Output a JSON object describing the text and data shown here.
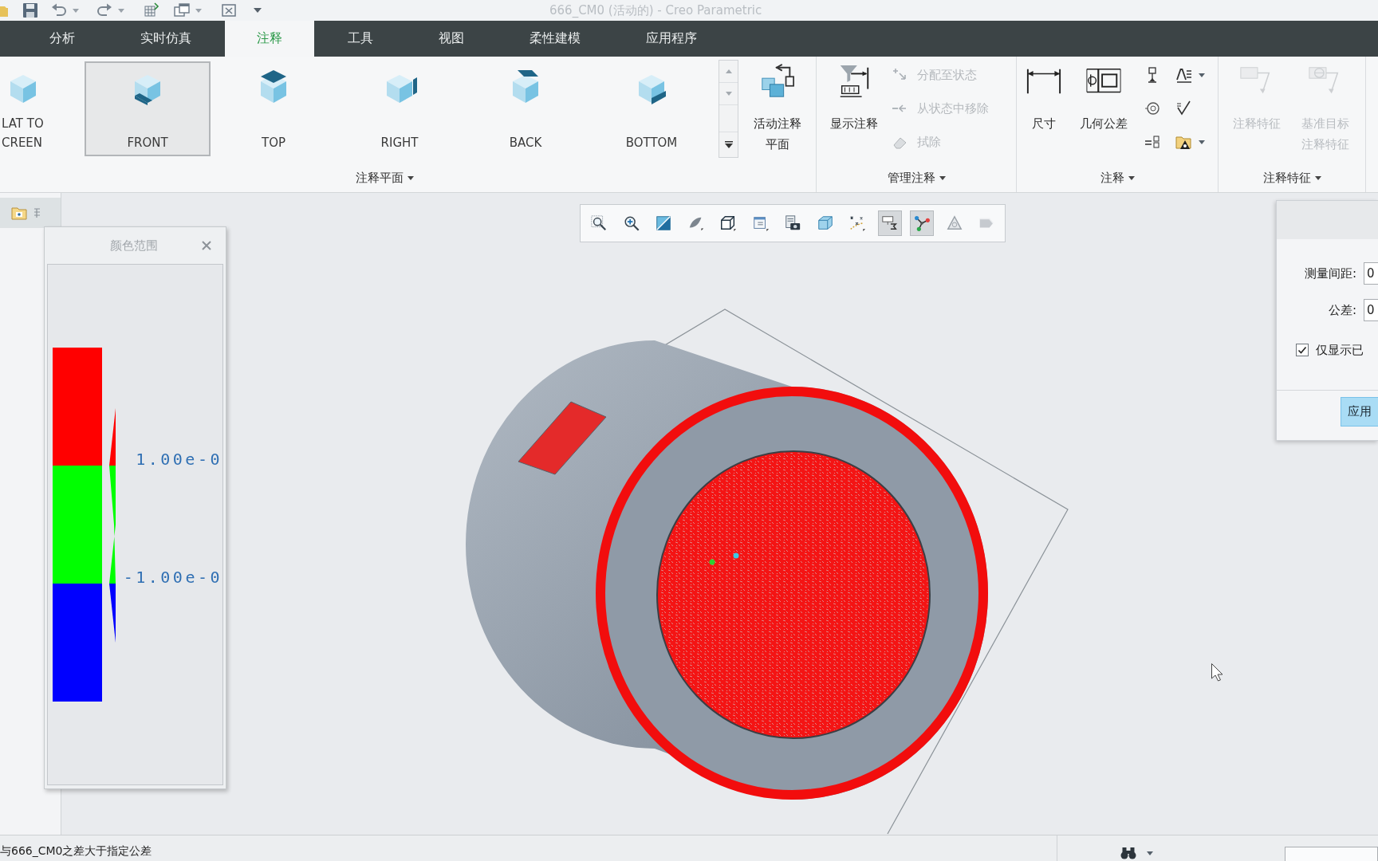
{
  "title_bar": {
    "title": "666_CM0 (活动的) - Creo Parametric"
  },
  "tabs": [
    {
      "label": "分析",
      "selected": false
    },
    {
      "label": "实时仿真",
      "selected": false
    },
    {
      "label": "注释",
      "selected": true
    },
    {
      "label": "工具",
      "selected": false
    },
    {
      "label": "视图",
      "selected": false
    },
    {
      "label": "柔性建模",
      "selected": false
    },
    {
      "label": "应用程序",
      "selected": false
    }
  ],
  "ribbon": {
    "groups": [
      {
        "label": "注释平面",
        "gallery": [
          {
            "label": "LAT TO\nCREEN",
            "selected": false
          },
          {
            "label": "FRONT",
            "selected": true
          },
          {
            "label": "TOP",
            "selected": false
          },
          {
            "label": "RIGHT",
            "selected": false
          },
          {
            "label": "BACK",
            "selected": false
          },
          {
            "label": "BOTTOM",
            "selected": false
          }
        ],
        "large_buttons": [
          {
            "label": "活动注释平面",
            "disabled": false
          }
        ]
      },
      {
        "label": "管理注释",
        "large_buttons": [
          {
            "label": "显示注释",
            "disabled": false
          }
        ],
        "small_buttons": [
          {
            "label": "分配至状态",
            "disabled": true
          },
          {
            "label": "从状态中移除",
            "disabled": true
          },
          {
            "label": "拭除",
            "disabled": true
          }
        ]
      },
      {
        "label": "注释",
        "large_buttons": [
          {
            "label": "尺寸",
            "disabled": false
          },
          {
            "label": "几何公差",
            "disabled": false
          }
        ]
      },
      {
        "label": "注释特征",
        "large_buttons": [
          {
            "label": "注释特征",
            "disabled": true
          },
          {
            "label": "基准目标注释特征",
            "disabled": true
          }
        ]
      }
    ]
  },
  "view_toolbar": {
    "buttons": [
      {
        "pressed": false
      },
      {
        "pressed": false
      },
      {
        "pressed": false
      },
      {
        "pressed": false
      },
      {
        "pressed": false
      },
      {
        "pressed": false
      },
      {
        "pressed": false
      },
      {
        "pressed": false
      },
      {
        "pressed": false
      },
      {
        "pressed": true
      },
      {
        "pressed": true
      },
      {
        "pressed": false
      },
      {
        "pressed": false
      }
    ]
  },
  "color_range_dialog": {
    "title": "颜色范围",
    "bands": [
      {
        "color": "#ff0000"
      },
      {
        "color": "#00ff00"
      },
      {
        "color": "#0000ff"
      }
    ],
    "tick_labels": [
      "1.00e-0",
      "-1.00e-0"
    ]
  },
  "measure_dialog": {
    "fields": [
      {
        "label": "测量间距:",
        "value": "0"
      },
      {
        "label": "公差:",
        "value": "0"
      }
    ],
    "checkbox": {
      "label": "仅显示已",
      "checked": true
    },
    "apply_button": "应用"
  },
  "status_bar": {
    "message": "与666_CM0之差大于指定公差"
  }
}
